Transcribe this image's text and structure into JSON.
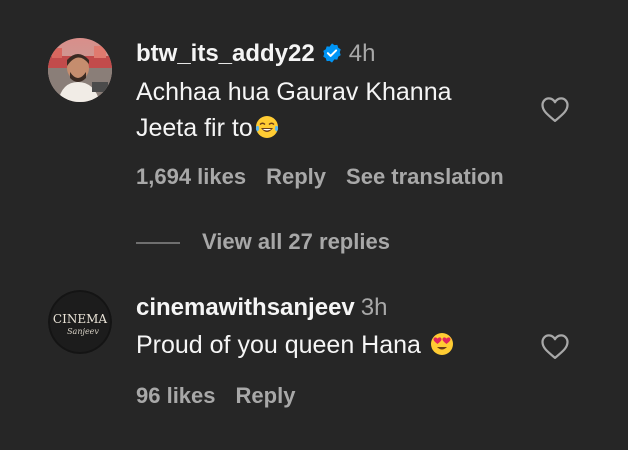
{
  "comments": [
    {
      "username": "btw_its_addy22",
      "verified": true,
      "time": "4h",
      "text_line1": "Achhaa hua Gaurav Khanna",
      "text_line2": "Jeeta fir to",
      "emoji": "face-with-tears-of-joy",
      "likes": "1,694 likes",
      "reply_label": "Reply",
      "translate_label": "See translation",
      "view_replies_label": "View all 27 replies"
    },
    {
      "username": "cinemawithsanjeev",
      "time": "3h",
      "text": "Proud of you queen Hana",
      "emoji": "heart-eyes",
      "likes": "96 likes",
      "reply_label": "Reply",
      "avatar_text_top": "CINEMA",
      "avatar_text_bottom": "Sanjeev"
    }
  ],
  "colors": {
    "background": "#262626",
    "primary_text": "#f5f5f5",
    "secondary_text": "#a8a8a8",
    "verified": "#0095f6"
  }
}
